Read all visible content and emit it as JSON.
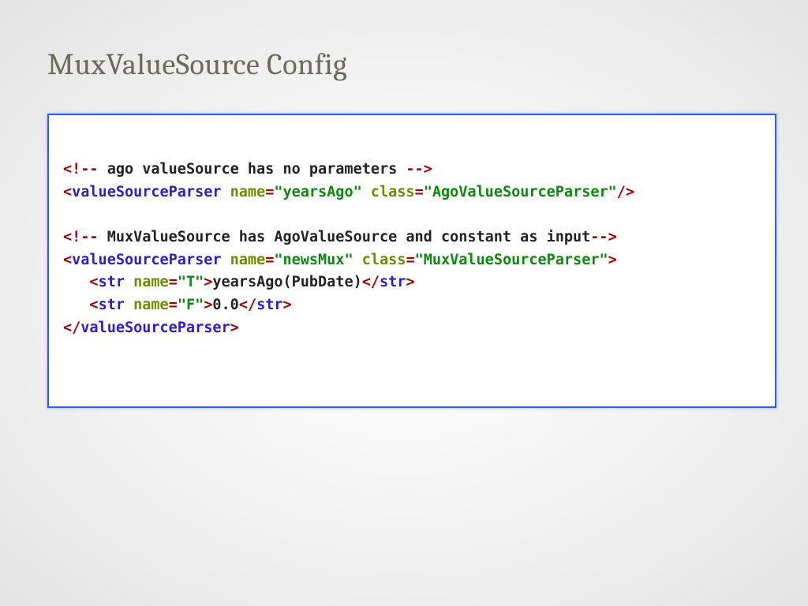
{
  "title": "MuxValueSource Config",
  "xml": {
    "comment1": " ago valueSource has no parameters ",
    "vsp1": {
      "tag": "valueSourceParser",
      "nameAttr": "name",
      "nameVal": "\"yearsAgo\"",
      "classAttr": "class",
      "classVal": "\"AgoValueSourceParser\""
    },
    "comment2": " MuxValueSource has AgoValueSource and constant as input",
    "vsp2": {
      "tag": "valueSourceParser",
      "nameAttr": "name",
      "nameVal": "\"newsMux\"",
      "classAttr": "class",
      "classVal": "\"MuxValueSourceParser\""
    },
    "str1": {
      "tag": "str",
      "nameAttr": "name",
      "nameVal": "\"T\"",
      "text": "yearsAgo(PubDate)"
    },
    "str2": {
      "tag": "str",
      "nameAttr": "name",
      "nameVal": "\"F\"",
      "text": "0.0"
    },
    "closeVsp": "valueSourceParser"
  }
}
